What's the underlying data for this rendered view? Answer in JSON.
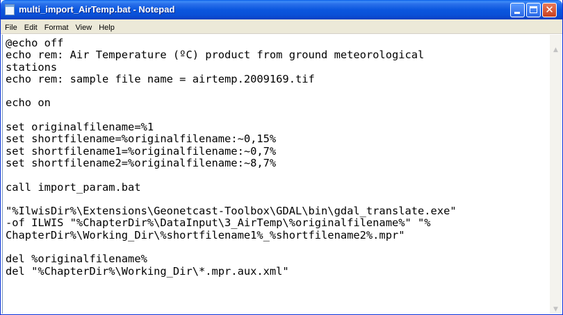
{
  "window": {
    "title": "multi_import_AirTemp.bat - Notepad",
    "minimize_glyph": "",
    "maximize_glyph": "",
    "close_glyph": "✕"
  },
  "menu": {
    "items": [
      "File",
      "Edit",
      "Format",
      "View",
      "Help"
    ]
  },
  "editor": {
    "lines": [
      "@echo off",
      "echo rem: Air Temperature (ºC) product from ground meteorological",
      "stations",
      "echo rem: sample file name = airtemp.2009169.tif",
      "",
      "echo on",
      "",
      "set originalfilename=%1",
      "set shortfilename=%originalfilename:~0,15%",
      "set shortfilename1=%originalfilename:~0,7%",
      "set shortfilename2=%originalfilename:~8,7%",
      "",
      "call import_param.bat",
      "",
      "\"%IlwisDir%\\Extensions\\Geonetcast-Toolbox\\GDAL\\bin\\gdal_translate.exe\"",
      "-of ILWIS \"%ChapterDir%\\DataInput\\3_AirTemp\\%originalfilename%\" \"%",
      "ChapterDir%\\Working_Dir\\%shortfilename1%_%shortfilename2%.mpr\"",
      "",
      "del %originalfilename%",
      "del \"%ChapterDir%\\Working_Dir\\*.mpr.aux.xml\""
    ]
  },
  "scrollbar": {
    "up_arrow": "▲",
    "down_arrow": "▼"
  }
}
